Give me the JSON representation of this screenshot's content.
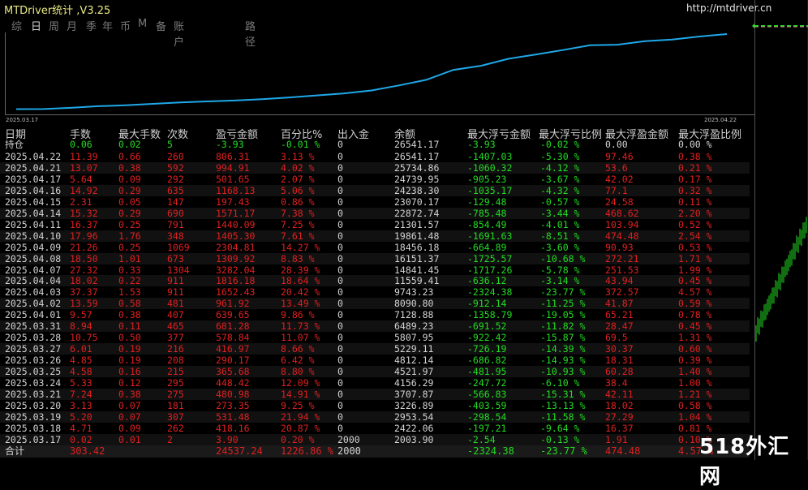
{
  "window": {
    "title": "MTDriver统计 ,V3.25",
    "url": "http://mtdriver.cn"
  },
  "tabs": [
    "综",
    "日",
    "周",
    "月",
    "季",
    "年",
    "币",
    "M",
    "备",
    "账户",
    "路径"
  ],
  "active_tab": 1,
  "chart": {
    "start_date": "2025.03.17",
    "end_date": "2025.04.22",
    "line_color": "#1fa8e8",
    "frame_color": "#666666"
  },
  "headers": [
    "日期",
    "手数",
    "最大手数",
    "次数",
    "盈亏金额",
    "百分比%",
    "出入金",
    "余额",
    "最大浮亏金额",
    "最大浮亏比例",
    "最大浮盈金额",
    "最大浮盈比例"
  ],
  "position_row": [
    "持仓",
    "0.06",
    "0.02",
    "5",
    "-3.93",
    "-0.01 %",
    "0",
    "26541.17",
    "-3.93",
    "-0.02 %",
    "0.00",
    "0.00 %"
  ],
  "rows": [
    [
      "2025.04.22",
      "11.39",
      "0.66",
      "260",
      "806.31",
      "3.13 %",
      "0",
      "26541.17",
      "-1407.03",
      "-5.30 %",
      "97.46",
      "0.38 %"
    ],
    [
      "2025.04.21",
      "13.07",
      "0.38",
      "592",
      "994.91",
      "4.02 %",
      "0",
      "25734.86",
      "-1060.32",
      "-4.12 %",
      "53.6",
      "0.21 %"
    ],
    [
      "2025.04.17",
      "5.64",
      "0.09",
      "292",
      "501.65",
      "2.07 %",
      "0",
      "24739.95",
      "-905.23",
      "-3.67 %",
      "42.02",
      "0.17 %"
    ],
    [
      "2025.04.16",
      "14.92",
      "0.29",
      "635",
      "1168.13",
      "5.06 %",
      "0",
      "24238.30",
      "-1035.17",
      "-4.32 %",
      "77.1",
      "0.32 %"
    ],
    [
      "2025.04.15",
      "2.31",
      "0.05",
      "147",
      "197.43",
      "0.86 %",
      "0",
      "23070.17",
      "-129.48",
      "-0.57 %",
      "24.58",
      "0.11 %"
    ],
    [
      "2025.04.14",
      "15.32",
      "0.29",
      "690",
      "1571.17",
      "7.38 %",
      "0",
      "22872.74",
      "-785.48",
      "-3.44 %",
      "468.62",
      "2.20 %"
    ],
    [
      "2025.04.11",
      "16.37",
      "0.25",
      "791",
      "1440.09",
      "7.25 %",
      "0",
      "21301.57",
      "-854.49",
      "-4.01 %",
      "103.94",
      "0.52 %"
    ],
    [
      "2025.04.10",
      "17.96",
      "1.76",
      "348",
      "1405.30",
      "7.61 %",
      "0",
      "19861.48",
      "-1691.63",
      "-8.51 %",
      "474.48",
      "2.54 %"
    ],
    [
      "2025.04.09",
      "21.26",
      "0.25",
      "1069",
      "2304.81",
      "14.27 %",
      "0",
      "18456.18",
      "-664.89",
      "-3.60 %",
      "90.93",
      "0.53 %"
    ],
    [
      "2025.04.08",
      "18.50",
      "1.01",
      "673",
      "1309.92",
      "8.83 %",
      "0",
      "16151.37",
      "-1725.57",
      "-10.68 %",
      "272.21",
      "1.71 %"
    ],
    [
      "2025.04.07",
      "27.32",
      "0.33",
      "1304",
      "3282.04",
      "28.39 %",
      "0",
      "14841.45",
      "-1717.26",
      "-5.78 %",
      "251.53",
      "1.99 %"
    ],
    [
      "2025.04.04",
      "18.02",
      "0.22",
      "911",
      "1816.18",
      "18.64 %",
      "0",
      "11559.41",
      "-636.12",
      "-3.14 %",
      "43.94",
      "0.45 %"
    ],
    [
      "2025.04.03",
      "37.37",
      "1.53",
      "911",
      "1652.43",
      "20.42 %",
      "0",
      "9743.23",
      "-2324.38",
      "-23.77 %",
      "372.57",
      "4.57 %"
    ],
    [
      "2025.04.02",
      "13.59",
      "0.58",
      "481",
      "961.92",
      "13.49 %",
      "0",
      "8090.80",
      "-912.14",
      "-11.25 %",
      "41.87",
      "0.59 %"
    ],
    [
      "2025.04.01",
      "9.57",
      "0.38",
      "407",
      "639.65",
      "9.86 %",
      "0",
      "7128.88",
      "-1358.79",
      "-19.05 %",
      "65.21",
      "0.78 %"
    ],
    [
      "2025.03.31",
      "8.94",
      "0.11",
      "465",
      "681.28",
      "11.73 %",
      "0",
      "6489.23",
      "-691.52",
      "-11.82 %",
      "28.47",
      "0.45 %"
    ],
    [
      "2025.03.28",
      "10.75",
      "0.50",
      "377",
      "578.84",
      "11.07 %",
      "0",
      "5807.95",
      "-922.42",
      "-15.87 %",
      "69.5",
      "1.31 %"
    ],
    [
      "2025.03.27",
      "6.01",
      "0.19",
      "216",
      "416.97",
      "8.66 %",
      "0",
      "5229.11",
      "-726.19",
      "-14.39 %",
      "30.37",
      "0.60 %"
    ],
    [
      "2025.03.26",
      "4.85",
      "0.19",
      "208",
      "290.17",
      "6.42 %",
      "0",
      "4812.14",
      "-686.82",
      "-14.93 %",
      "18.31",
      "0.39 %"
    ],
    [
      "2025.03.25",
      "4.58",
      "0.16",
      "215",
      "365.68",
      "8.80 %",
      "0",
      "4521.97",
      "-481.95",
      "-10.93 %",
      "60.28",
      "1.40 %"
    ],
    [
      "2025.03.24",
      "5.33",
      "0.12",
      "295",
      "448.42",
      "12.09 %",
      "0",
      "4156.29",
      "-247.72",
      "-6.10 %",
      "38.4",
      "1.00 %"
    ],
    [
      "2025.03.21",
      "7.24",
      "0.38",
      "275",
      "480.98",
      "14.91 %",
      "0",
      "3707.87",
      "-566.83",
      "-15.31 %",
      "42.11",
      "1.21 %"
    ],
    [
      "2025.03.20",
      "3.13",
      "0.07",
      "181",
      "273.35",
      "9.25 %",
      "0",
      "3226.89",
      "-403.59",
      "-13.13 %",
      "18.02",
      "0.58 %"
    ],
    [
      "2025.03.19",
      "5.20",
      "0.07",
      "307",
      "531.48",
      "21.94 %",
      "0",
      "2953.54",
      "-298.54",
      "-11.58 %",
      "27.29",
      "1.04 %"
    ],
    [
      "2025.03.18",
      "4.71",
      "0.09",
      "262",
      "418.16",
      "20.87 %",
      "0",
      "2422.06",
      "-197.21",
      "-9.64 %",
      "16.37",
      "0.81 %"
    ],
    [
      "2025.03.17",
      "0.02",
      "0.01",
      "2",
      "3.90",
      "0.20 %",
      "2000",
      "2003.90",
      "-2.54",
      "-0.13 %",
      "1.91",
      "0.10 %"
    ]
  ],
  "totals": [
    "合计",
    "303.42",
    "",
    "",
    "24537.24",
    "1226.86 %",
    "2000",
    "",
    "-2324.38",
    "-23.77 %",
    "474.48",
    "4.57 %"
  ],
  "colors": {
    "positive": "#e02020",
    "negative": "#22dd22",
    "neutral": "#d4d4d4",
    "header": "#cfcfcf",
    "title": "#e8e880"
  },
  "watermark": "518外汇网"
}
